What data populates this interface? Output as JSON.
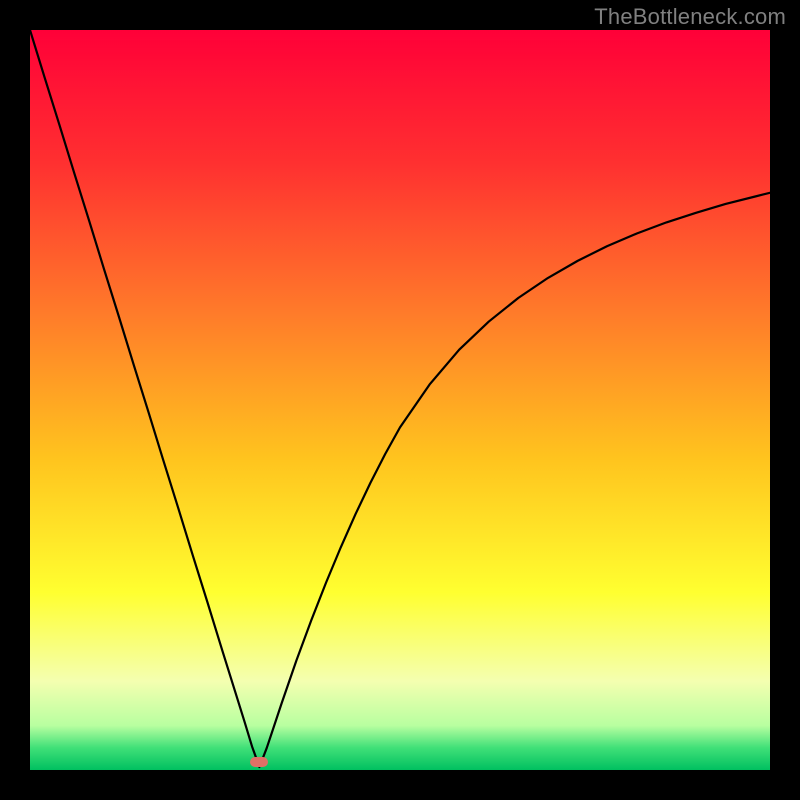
{
  "watermark": "TheBottleneck.com",
  "gradient_stops": [
    {
      "offset": "0%",
      "color": "#ff0038"
    },
    {
      "offset": "18%",
      "color": "#ff3030"
    },
    {
      "offset": "38%",
      "color": "#ff7a2a"
    },
    {
      "offset": "58%",
      "color": "#ffc41e"
    },
    {
      "offset": "76%",
      "color": "#ffff30"
    },
    {
      "offset": "88%",
      "color": "#f4ffb0"
    },
    {
      "offset": "94%",
      "color": "#b8ffa0"
    },
    {
      "offset": "97%",
      "color": "#40e078"
    },
    {
      "offset": "100%",
      "color": "#00c060"
    }
  ],
  "marker": {
    "x_pct": 31.0,
    "color": "#e07066"
  },
  "chart_data": {
    "type": "line",
    "title": "",
    "xlabel": "",
    "ylabel": "",
    "xlim": [
      0,
      100
    ],
    "ylim": [
      0,
      100
    ],
    "x": [
      0.0,
      2.0,
      4.0,
      6.0,
      8.0,
      10.0,
      12.0,
      14.0,
      16.0,
      18.0,
      20.0,
      22.0,
      24.0,
      26.0,
      28.0,
      29.0,
      30.0,
      31.0,
      32.0,
      33.0,
      34.0,
      36.0,
      38.0,
      40.0,
      42.0,
      44.0,
      46.0,
      48.0,
      50.0,
      54.0,
      58.0,
      62.0,
      66.0,
      70.0,
      74.0,
      78.0,
      82.0,
      86.0,
      90.0,
      94.0,
      98.0,
      100.0
    ],
    "values": [
      100.0,
      93.5,
      87.1,
      80.6,
      74.2,
      67.7,
      61.3,
      54.8,
      48.4,
      41.9,
      35.5,
      29.0,
      22.6,
      16.1,
      9.7,
      6.5,
      3.2,
      0.4,
      3.0,
      6.0,
      9.0,
      14.8,
      20.2,
      25.3,
      30.1,
      34.6,
      38.8,
      42.7,
      46.3,
      52.1,
      56.8,
      60.6,
      63.8,
      66.5,
      68.8,
      70.8,
      72.5,
      74.0,
      75.3,
      76.5,
      77.5,
      78.0
    ]
  }
}
